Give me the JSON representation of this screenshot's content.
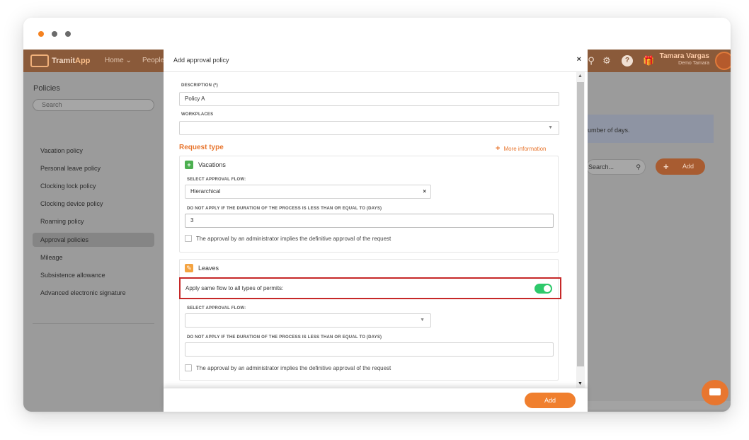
{
  "browser": {
    "dots": [
      "#f58220",
      "#6b6b6b",
      "#6b6b6b"
    ]
  },
  "topnav": {
    "logo_prefix": "Tramit",
    "logo_suffix": "App",
    "links": [
      "Home ⌄",
      "People"
    ],
    "user_name": "Tamara Vargas",
    "user_company": "Demo Tamara"
  },
  "sidebar": {
    "title": "Policies",
    "search_placeholder": "Search",
    "items": [
      {
        "label": "Vacation policy"
      },
      {
        "label": "Personal leave policy"
      },
      {
        "label": "Clocking lock policy"
      },
      {
        "label": "Clocking device policy"
      },
      {
        "label": "Roaming policy"
      },
      {
        "label": "Approval policies",
        "active": true
      },
      {
        "label": "Mileage"
      },
      {
        "label": "Subsistence allowance"
      },
      {
        "label": "Advanced electronic signature"
      }
    ]
  },
  "background": {
    "info_text": "umber of days.",
    "search_placeholder": "Search...",
    "add_label": "Add"
  },
  "modal": {
    "title": "Add approval policy",
    "close_label": "×",
    "description_label": "DESCRIPTION (*)",
    "description_value": "Policy A",
    "workplaces_label": "WORKPLACES",
    "workplaces_value": "",
    "request_type_title": "Request type",
    "more_info_label": "More information",
    "vacations": {
      "title": "Vacations",
      "flow_label": "SELECT APPROVAL FLOW:",
      "flow_value": "Hierarchical",
      "duration_label": "DO NOT APPLY IF THE DURATION OF THE PROCESS IS LESS THAN OR EQUAL TO (DAYS)",
      "duration_value": "3",
      "admin_check_label": "The approval by an administrator implies the definitive approval of the request"
    },
    "leaves": {
      "title": "Leaves",
      "same_flow_label": "Apply same flow to all types of permits:",
      "same_flow_on": true,
      "flow_label": "SELECT APPROVAL FLOW:",
      "flow_value": "",
      "duration_label": "DO NOT APPLY IF THE DURATION OF THE PROCESS IS LESS THAN OR EQUAL TO (DAYS)",
      "duration_value": "",
      "admin_check_label": "The approval by an administrator implies the definitive approval of the request"
    },
    "add_button_label": "Add"
  }
}
